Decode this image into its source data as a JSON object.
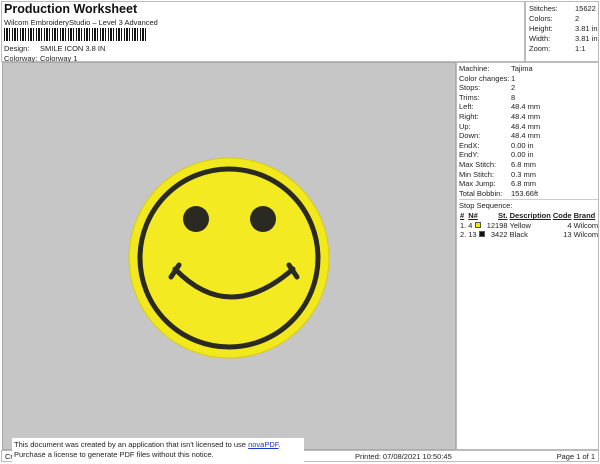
{
  "header": {
    "title": "Production Worksheet",
    "subtitle": "Wilcom EmbroideryStudio – Level 3 Advanced",
    "design_label": "Design:",
    "design": "SMILE ICON 3.8 IN",
    "colorway_label": "Colorway:",
    "colorway": "Colorway 1"
  },
  "summary": [
    {
      "k": "Stitches:",
      "v": "15622"
    },
    {
      "k": "Colors:",
      "v": "2"
    },
    {
      "k": "Height:",
      "v": "3.81 in"
    },
    {
      "k": "Width:",
      "v": "3.81 in"
    },
    {
      "k": "Zoom:",
      "v": "1:1"
    }
  ],
  "details": [
    {
      "k": "Machine:",
      "v": "Tajima"
    },
    {
      "k": "Color changes:",
      "v": "1"
    },
    {
      "k": "Stops:",
      "v": "2"
    },
    {
      "k": "Trims:",
      "v": "8"
    },
    {
      "k": "Left:",
      "v": "48.4 mm"
    },
    {
      "k": "Right:",
      "v": "48.4 mm"
    },
    {
      "k": "Up:",
      "v": "48.4 mm"
    },
    {
      "k": "Down:",
      "v": "48.4 mm"
    },
    {
      "k": "EndX:",
      "v": "0.00 in"
    },
    {
      "k": "EndY:",
      "v": "0.00 in"
    },
    {
      "k": "Max Stitch:",
      "v": "6.8 mm"
    },
    {
      "k": "Min Stitch:",
      "v": "0.3 mm"
    },
    {
      "k": "Max Jump:",
      "v": "6.8 mm"
    },
    {
      "k": "Total Bobbin:",
      "v": "153.66ft"
    }
  ],
  "stop_sequence": {
    "title": "Stop Sequence:",
    "columns": [
      "#",
      "N#",
      "St.",
      "Description",
      "Code",
      "Brand"
    ],
    "rows": [
      {
        "idx": "1.",
        "n": "4",
        "color": "#f5e800",
        "st": "12198",
        "desc": "Yellow",
        "code": "4",
        "brand": "Wilcom"
      },
      {
        "idx": "2.",
        "n": "13",
        "color": "#111111",
        "st": "3422",
        "desc": "Black",
        "code": "13",
        "brand": "Wilcom"
      }
    ]
  },
  "design_colors": {
    "yellow": "#f2e81e",
    "black": "#2a2a22"
  },
  "footer": {
    "left": "Cr",
    "printed": "Printed: 07/08/2021 10:50:45",
    "page": "Page 1 of 1"
  },
  "notice": {
    "line1": "This document was created by an application that isn't licensed to use ",
    "link": "novaPDF",
    "line1_end": ".",
    "line2": "Purchase a license to generate PDF files without this notice."
  }
}
